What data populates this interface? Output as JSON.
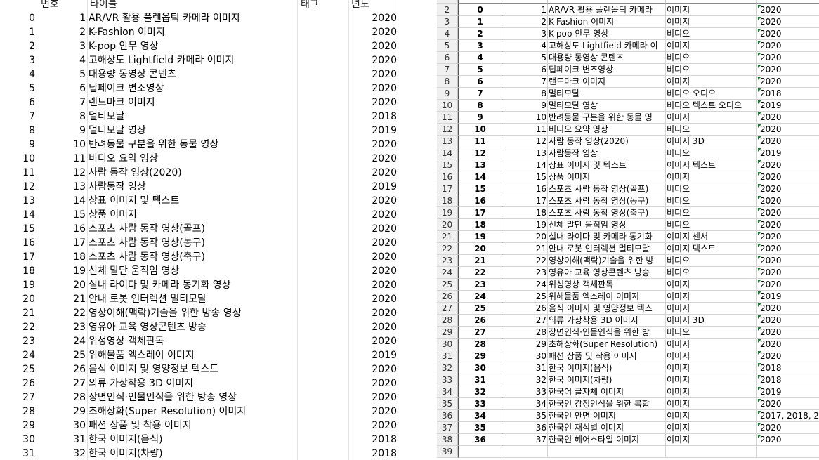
{
  "left_pane": {
    "columns": {
      "num": "번호",
      "title": "타이틀",
      "tag": "태그",
      "year": "년도"
    },
    "rows": [
      {
        "idx": "0",
        "num": "1",
        "title": "AR/VR 활용 플렌옵틱 카메라 이미지",
        "year": "2020"
      },
      {
        "idx": "1",
        "num": "2",
        "title": "K-Fashion 이미지",
        "year": "2020"
      },
      {
        "idx": "2",
        "num": "3",
        "title": "K-pop 안무 영상",
        "year": "2020"
      },
      {
        "idx": "3",
        "num": "4",
        "title": "고해상도 Lightfield 카메라 이미지",
        "year": "2020"
      },
      {
        "idx": "4",
        "num": "5",
        "title": "대용량 동영상 콘텐츠",
        "year": "2020"
      },
      {
        "idx": "5",
        "num": "6",
        "title": "딥페이크 변조영상",
        "year": "2020"
      },
      {
        "idx": "6",
        "num": "7",
        "title": "랜드마크 이미지",
        "year": "2020"
      },
      {
        "idx": "7",
        "num": "8",
        "title": "멀티모달",
        "year": "2018"
      },
      {
        "idx": "8",
        "num": "9",
        "title": "멀티모달 영상",
        "year": "2019"
      },
      {
        "idx": "9",
        "num": "10",
        "title": "반려동물 구분을 위한 동물 영상",
        "year": "2020"
      },
      {
        "idx": "10",
        "num": "11",
        "title": "비디오 요약 영상",
        "year": "2020"
      },
      {
        "idx": "11",
        "num": "12",
        "title": "사람 동작 영상(2020)",
        "year": "2020"
      },
      {
        "idx": "12",
        "num": "13",
        "title": "사람동작 영상",
        "year": "2019"
      },
      {
        "idx": "13",
        "num": "14",
        "title": "상표 이미지 및 텍스트",
        "year": "2020"
      },
      {
        "idx": "14",
        "num": "15",
        "title": "상품 이미지",
        "year": "2020"
      },
      {
        "idx": "15",
        "num": "16",
        "title": "스포츠 사람 동작 영상(골프)",
        "year": "2020"
      },
      {
        "idx": "16",
        "num": "17",
        "title": "스포츠 사람 동작 영상(농구)",
        "year": "2020"
      },
      {
        "idx": "17",
        "num": "18",
        "title": "스포츠 사람 동작 영상(축구)",
        "year": "2020"
      },
      {
        "idx": "18",
        "num": "19",
        "title": "신체 말단 움직임 영상",
        "year": "2020"
      },
      {
        "idx": "19",
        "num": "20",
        "title": "실내 라이다 및 카메라 동기화 영상",
        "year": "2020"
      },
      {
        "idx": "20",
        "num": "21",
        "title": "안내 로봇 인터렉션 멀티모달",
        "year": "2020"
      },
      {
        "idx": "21",
        "num": "22",
        "title": "영상이해(맥락)기술을 위한 방송 영상",
        "year": "2020"
      },
      {
        "idx": "22",
        "num": "23",
        "title": "영유아 교육 영상콘텐츠 방송",
        "year": "2020"
      },
      {
        "idx": "23",
        "num": "24",
        "title": "위성영상 객체판독",
        "year": "2020"
      },
      {
        "idx": "24",
        "num": "25",
        "title": "위해물품 엑스레이 이미지",
        "year": "2019"
      },
      {
        "idx": "25",
        "num": "26",
        "title": "음식 이미지 및 영양정보 텍스트",
        "year": "2020"
      },
      {
        "idx": "26",
        "num": "27",
        "title": "의류 가상착용 3D 이미지",
        "year": "2020"
      },
      {
        "idx": "27",
        "num": "28",
        "title": "장면인식·인물인식을 위한 방송 영상",
        "year": "2020"
      },
      {
        "idx": "28",
        "num": "29",
        "title": "초해상화(Super Resolution) 이미지",
        "year": "2020"
      },
      {
        "idx": "29",
        "num": "30",
        "title": "패션 상품 및 착용 이미지",
        "year": "2020"
      },
      {
        "idx": "30",
        "num": "31",
        "title": "한국 이미지(음식)",
        "year": "2018"
      },
      {
        "idx": "31",
        "num": "32",
        "title": "한국 이미지(차량)",
        "year": "2018"
      }
    ]
  },
  "right_pane": {
    "rows": [
      {
        "row": "2",
        "idx": "0",
        "num": "1",
        "title": "AR/VR 활용 플렌옵틱 카메라",
        "tag": "이미지",
        "year": "2020"
      },
      {
        "row": "3",
        "idx": "1",
        "num": "2",
        "title": "K-Fashion 이미지",
        "tag": "이미지",
        "year": "2020"
      },
      {
        "row": "4",
        "idx": "2",
        "num": "3",
        "title": "K-pop 안무 영상",
        "tag": "비디오",
        "year": "2020"
      },
      {
        "row": "5",
        "idx": "3",
        "num": "4",
        "title": "고해상도 Lightfield 카메라 이",
        "tag": "이미지",
        "year": "2020"
      },
      {
        "row": "6",
        "idx": "4",
        "num": "5",
        "title": "대용량 동영상 콘텐츠",
        "tag": "비디오",
        "year": "2020"
      },
      {
        "row": "7",
        "idx": "5",
        "num": "6",
        "title": "딥페이크 변조영상",
        "tag": "비디오",
        "year": "2020"
      },
      {
        "row": "8",
        "idx": "6",
        "num": "7",
        "title": "랜드마크 이미지",
        "tag": "이미지",
        "year": "2020"
      },
      {
        "row": "9",
        "idx": "7",
        "num": "8",
        "title": "멀티모달",
        "tag": "비디오 오디오",
        "year": "2018"
      },
      {
        "row": "10",
        "idx": "8",
        "num": "9",
        "title": "멀티모달 영상",
        "tag": "비디오 텍스트 오디오",
        "year": "2019"
      },
      {
        "row": "11",
        "idx": "9",
        "num": "10",
        "title": "반려동물 구분을 위한 동물 영",
        "tag": "이미지",
        "year": "2020"
      },
      {
        "row": "12",
        "idx": "10",
        "num": "11",
        "title": "비디오 요약 영상",
        "tag": "비디오",
        "year": "2020"
      },
      {
        "row": "13",
        "idx": "11",
        "num": "12",
        "title": "사람 동작 영상(2020)",
        "tag": "이미지 3D",
        "year": "2020"
      },
      {
        "row": "14",
        "idx": "12",
        "num": "13",
        "title": "사람동작 영상",
        "tag": "비디오",
        "year": "2019"
      },
      {
        "row": "15",
        "idx": "13",
        "num": "14",
        "title": "상표 이미지 및 텍스트",
        "tag": "이미지 텍스트",
        "year": "2020"
      },
      {
        "row": "16",
        "idx": "14",
        "num": "15",
        "title": "상품 이미지",
        "tag": "이미지",
        "year": "2020"
      },
      {
        "row": "17",
        "idx": "15",
        "num": "16",
        "title": "스포츠 사람 동작 영상(골프)",
        "tag": "비디오",
        "year": "2020"
      },
      {
        "row": "18",
        "idx": "16",
        "num": "17",
        "title": "스포츠 사람 동작 영상(농구)",
        "tag": "비디오",
        "year": "2020"
      },
      {
        "row": "19",
        "idx": "17",
        "num": "18",
        "title": "스포츠 사람 동작 영상(축구)",
        "tag": "비디오",
        "year": "2020"
      },
      {
        "row": "20",
        "idx": "18",
        "num": "19",
        "title": "신체 말단 움직임 영상",
        "tag": "비디오",
        "year": "2020"
      },
      {
        "row": "21",
        "idx": "19",
        "num": "20",
        "title": "실내 라이다 및 카메라 동기화",
        "tag": "이미지 센서",
        "year": "2020"
      },
      {
        "row": "22",
        "idx": "20",
        "num": "21",
        "title": "안내 로봇 인터렉션 멀티모달",
        "tag": "이미지 텍스트",
        "year": "2020"
      },
      {
        "row": "23",
        "idx": "21",
        "num": "22",
        "title": "영상이해(맥락)기술을 위한 방",
        "tag": "비디오",
        "year": "2020"
      },
      {
        "row": "24",
        "idx": "22",
        "num": "23",
        "title": "영유아 교육 영상콘텐츠 방송",
        "tag": "비디오",
        "year": "2020"
      },
      {
        "row": "25",
        "idx": "23",
        "num": "24",
        "title": "위성영상 객체판독",
        "tag": "이미지",
        "year": "2020"
      },
      {
        "row": "26",
        "idx": "24",
        "num": "25",
        "title": "위해물품 엑스레이 이미지",
        "tag": "이미지",
        "year": "2019"
      },
      {
        "row": "27",
        "idx": "25",
        "num": "26",
        "title": "음식 이미지 및 영양정보 텍스",
        "tag": "이미지",
        "year": "2020"
      },
      {
        "row": "28",
        "idx": "26",
        "num": "27",
        "title": "의류 가상착용 3D 이미지",
        "tag": "이미지 3D",
        "year": "2020"
      },
      {
        "row": "29",
        "idx": "27",
        "num": "28",
        "title": "장면인식·인물인식을 위한 방",
        "tag": "비디오",
        "year": "2020"
      },
      {
        "row": "30",
        "idx": "28",
        "num": "29",
        "title": "초해상화(Super Resolution)",
        "tag": "이미지",
        "year": "2020"
      },
      {
        "row": "31",
        "idx": "29",
        "num": "30",
        "title": "패션 상품 및 착용 이미지",
        "tag": "이미지",
        "year": "2020"
      },
      {
        "row": "32",
        "idx": "30",
        "num": "31",
        "title": "한국 이미지(음식)",
        "tag": "이미지",
        "year": "2018"
      },
      {
        "row": "33",
        "idx": "31",
        "num": "32",
        "title": "한국 이미지(차량)",
        "tag": "이미지",
        "year": "2018"
      },
      {
        "row": "34",
        "idx": "32",
        "num": "33",
        "title": "한국어 글자체 이미지",
        "tag": "이미지",
        "year": "2019"
      },
      {
        "row": "35",
        "idx": "33",
        "num": "34",
        "title": "한국인 감정인식을 위한 복합",
        "tag": "이미지",
        "year": "2020"
      },
      {
        "row": "36",
        "idx": "34",
        "num": "35",
        "title": "한국인 안면 이미지",
        "tag": "이미지",
        "year": "2017, 2018, 20"
      },
      {
        "row": "37",
        "idx": "35",
        "num": "36",
        "title": "한국인 재식별 이미지",
        "tag": "이미지",
        "year": "2020"
      },
      {
        "row": "38",
        "idx": "36",
        "num": "37",
        "title": "한국인 헤어스타일 이미지",
        "tag": "이미지",
        "year": "2020"
      },
      {
        "row": "39",
        "idx": "",
        "num": "",
        "title": "",
        "tag": "",
        "year": ""
      }
    ]
  }
}
